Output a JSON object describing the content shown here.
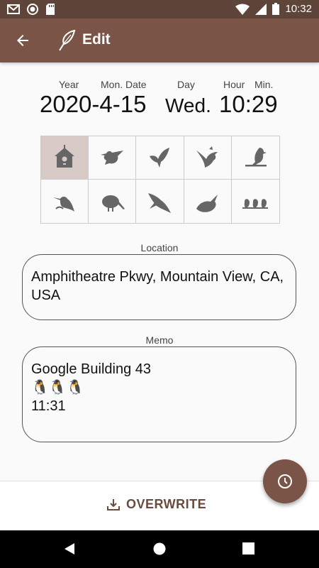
{
  "status_bar": {
    "time": "10:32",
    "left_icons": [
      "gmail-icon",
      "record-icon",
      "sd-card-icon"
    ],
    "right_icons": [
      "wifi-icon",
      "signal-icon",
      "battery-icon"
    ]
  },
  "toolbar": {
    "title": "Edit",
    "back_icon": "arrow-left-icon",
    "title_icon": "feather-icon"
  },
  "datetime": {
    "labels": {
      "year": "Year",
      "mon_date": "Mon. Date",
      "day": "Day",
      "hour": "Hour",
      "min": "Min."
    },
    "date": "2020-4-15",
    "weekday": "Wed.",
    "time": "10:29"
  },
  "bird_grid": {
    "icons": [
      "birdhouse-icon",
      "pigeon-icon",
      "swallow-icon",
      "hummingbird-icon",
      "kingfisher-perched-icon",
      "kingfisher-icon",
      "kiwi-icon",
      "diving-bird-icon",
      "flying-bird-icon",
      "three-birds-icon"
    ],
    "selected_index": 0
  },
  "location": {
    "label": "Location",
    "value": "Amphitheatre Pkwy, Mountain View, CA, USA"
  },
  "memo": {
    "label": "Memo",
    "lines": [
      "Google Building 43",
      "🐧🐧🐧",
      "11:31"
    ]
  },
  "actions": {
    "overwrite_label": "OVERWRITE",
    "overwrite_icon": "download-icon",
    "fab_icon": "clock-icon"
  },
  "nav_bar": {
    "icons": [
      "back-triangle-icon",
      "home-circle-icon",
      "recents-square-icon"
    ]
  },
  "colors": {
    "status_bar": "#5e4439",
    "toolbar": "#7a5447",
    "accent": "#6b4a3f",
    "selected_cell": "#d8cbc7"
  }
}
